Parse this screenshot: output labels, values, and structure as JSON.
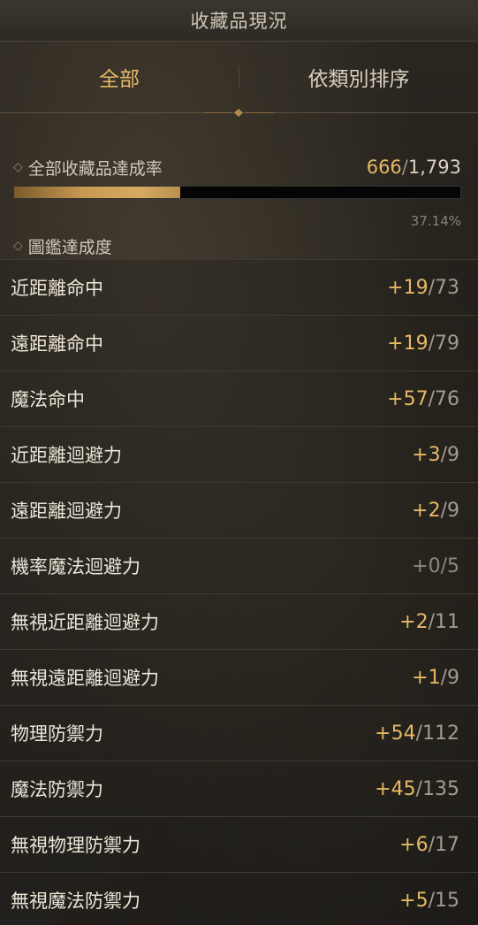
{
  "header": {
    "title": "收藏品現況"
  },
  "tabs": [
    {
      "label": "全部",
      "active": true
    },
    {
      "label": "依類別排序",
      "active": false
    }
  ],
  "summary": {
    "total_label": "全部收藏品達成率",
    "total_current": "666",
    "total_separator": "/",
    "total_max": "1,793",
    "progress_percent_text": "37.14%",
    "progress_fraction": 0.3714,
    "codex_label": "圖鑑達成度"
  },
  "stats": [
    {
      "name": "近距離命中",
      "current": "+19",
      "max": "/73"
    },
    {
      "name": "遠距離命中",
      "current": "+19",
      "max": "/79"
    },
    {
      "name": "魔法命中",
      "current": "+57",
      "max": "/76"
    },
    {
      "name": "近距離迴避力",
      "current": "+3",
      "max": "/9"
    },
    {
      "name": "遠距離迴避力",
      "current": "+2",
      "max": "/9"
    },
    {
      "name": "機率魔法迴避力",
      "current": "+0",
      "max": "/5"
    },
    {
      "name": "無視近距離迴避力",
      "current": "+2",
      "max": "/11"
    },
    {
      "name": "無視遠距離迴避力",
      "current": "+1",
      "max": "/9"
    },
    {
      "name": "物理防禦力",
      "current": "+54",
      "max": "/112"
    },
    {
      "name": "魔法防禦力",
      "current": "+45",
      "max": "/135"
    },
    {
      "name": "無視物理防禦力",
      "current": "+6",
      "max": "/17"
    },
    {
      "name": "無視魔法防禦力",
      "current": "+5",
      "max": "/15"
    }
  ],
  "colors": {
    "accent_gold": "#e6b866",
    "text_light": "#ece6d8",
    "text_dim": "#a39b8d"
  }
}
